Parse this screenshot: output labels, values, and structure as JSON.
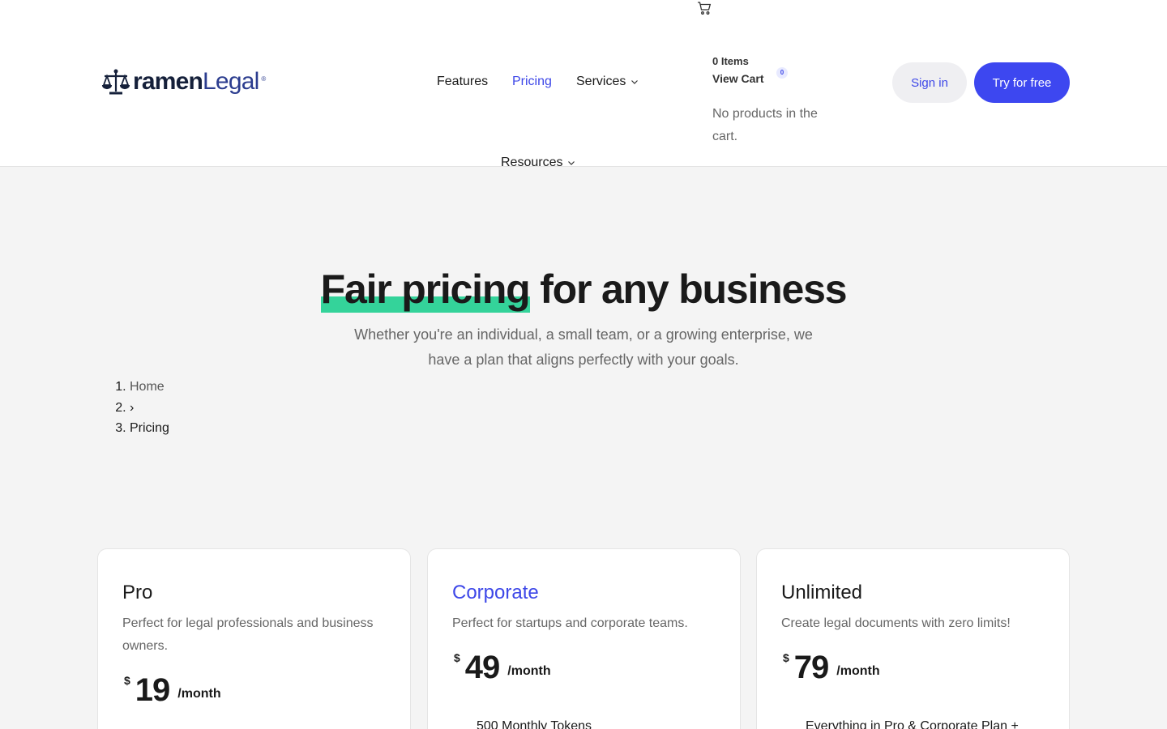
{
  "header": {
    "logo": {
      "brand_bold": "ramen",
      "brand_light": "Legal",
      "reg_mark": "®"
    },
    "nav": {
      "features": "Features",
      "pricing": "Pricing",
      "services": "Services",
      "resources": "Resources"
    },
    "cart": {
      "items_label": "0 Items",
      "view_cart": "View Cart",
      "count": "0",
      "empty_message": "No products in the cart."
    },
    "sign_in": "Sign in",
    "try_free": "Try for free",
    "colors": {
      "accent": "#3d47f0",
      "highlight": "#34d39a"
    }
  },
  "hero": {
    "title_highlight": "Fair pricing",
    "title_rest": " for any business",
    "subtitle": "Whether you're an individual, a small team, or a growing enterprise, we have a plan that aligns perfectly with your goals."
  },
  "breadcrumb": {
    "home": "Home",
    "separator": "›",
    "current": "Pricing"
  },
  "plans": [
    {
      "name": "Pro",
      "description": "Perfect for legal professionals and business owners.",
      "currency": "$",
      "price": "19",
      "period": "/month",
      "first_feature": ""
    },
    {
      "name": "Corporate",
      "description": "Perfect for startups and corporate teams.",
      "currency": "$",
      "price": "49",
      "period": "/month",
      "first_feature": "500 Monthly Tokens"
    },
    {
      "name": "Unlimited",
      "description": "Create legal documents with zero limits!",
      "currency": "$",
      "price": "79",
      "period": "/month",
      "first_feature": "Everything in Pro & Corporate Plan +"
    }
  ]
}
